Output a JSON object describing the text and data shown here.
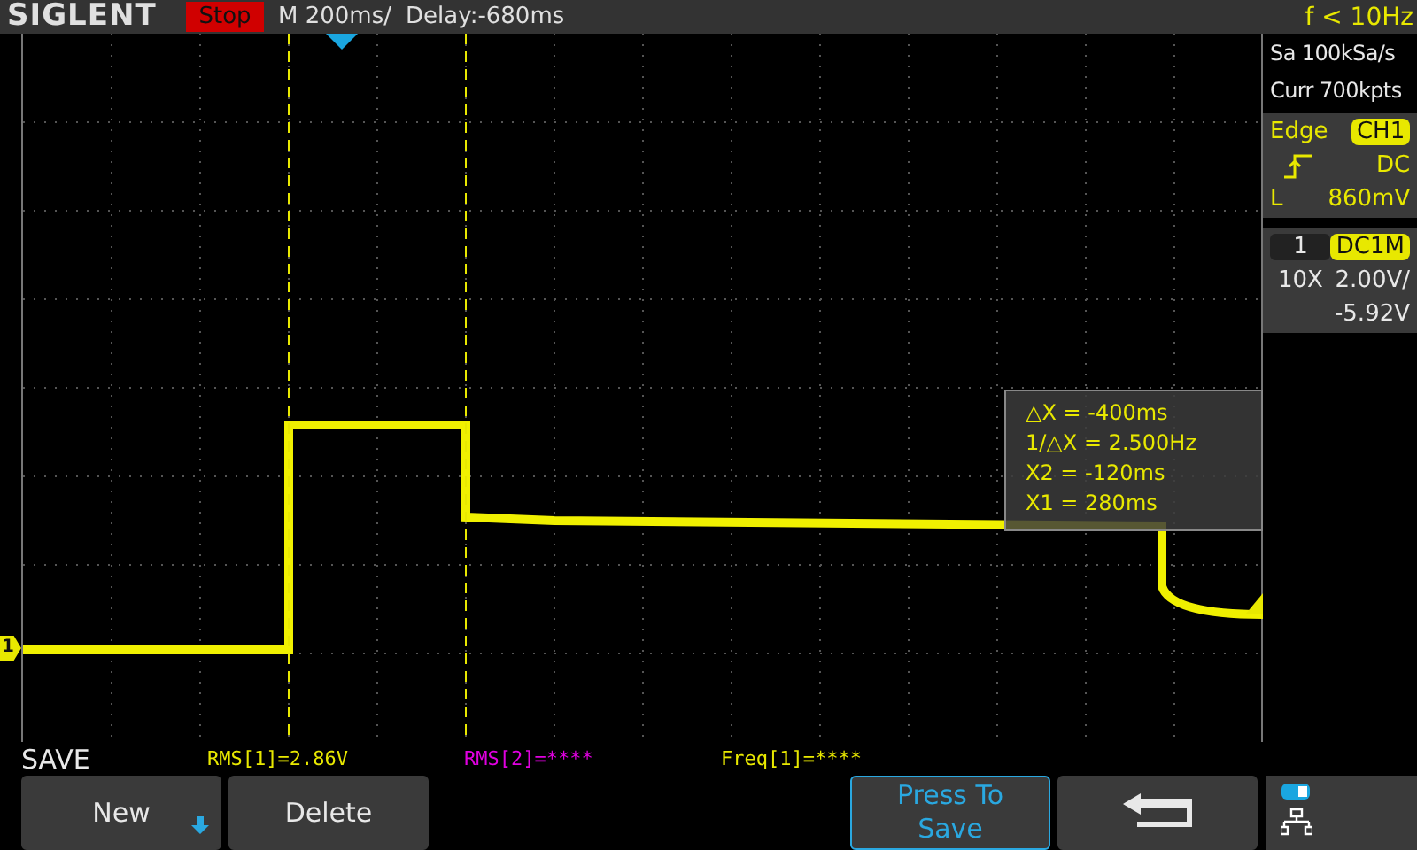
{
  "header": {
    "brand": "SIGLENT",
    "run_state": "Stop",
    "timebase": "M 200ms/",
    "delay": "Delay:-680ms",
    "frequency": "f < 10Hz"
  },
  "acquisition": {
    "sample_rate": "Sa 100kSa/s",
    "memory_depth": "Curr 700kpts"
  },
  "trigger": {
    "type": "Edge",
    "source": "CH1",
    "coupling": "DC",
    "level_label": "L",
    "level": "860mV"
  },
  "channel": {
    "number": "1",
    "coupling": "DC1M",
    "probe": "10X",
    "scale": "2.00V/",
    "offset": "-5.92V"
  },
  "channel_marker": "1",
  "cursor_readout": [
    "△X = -400ms",
    "1/△X = 2.500Hz",
    "X2 = -120ms",
    "X1 = 280ms"
  ],
  "menu_title": "SAVE",
  "measurements": [
    {
      "text": "RMS[1]=2.86V",
      "color": "#e8e800"
    },
    {
      "text": "RMS[2]=****",
      "color": "#e000e0"
    },
    {
      "text": "Freq[1]=****",
      "color": "#e8e800"
    }
  ],
  "softkeys": [
    {
      "kind": "dropdown",
      "label": "New"
    },
    {
      "kind": "plain",
      "label": "Delete"
    },
    {
      "kind": "empty"
    },
    {
      "kind": "empty"
    },
    {
      "kind": "accent",
      "label": "Press To Save"
    },
    {
      "kind": "back"
    }
  ]
}
